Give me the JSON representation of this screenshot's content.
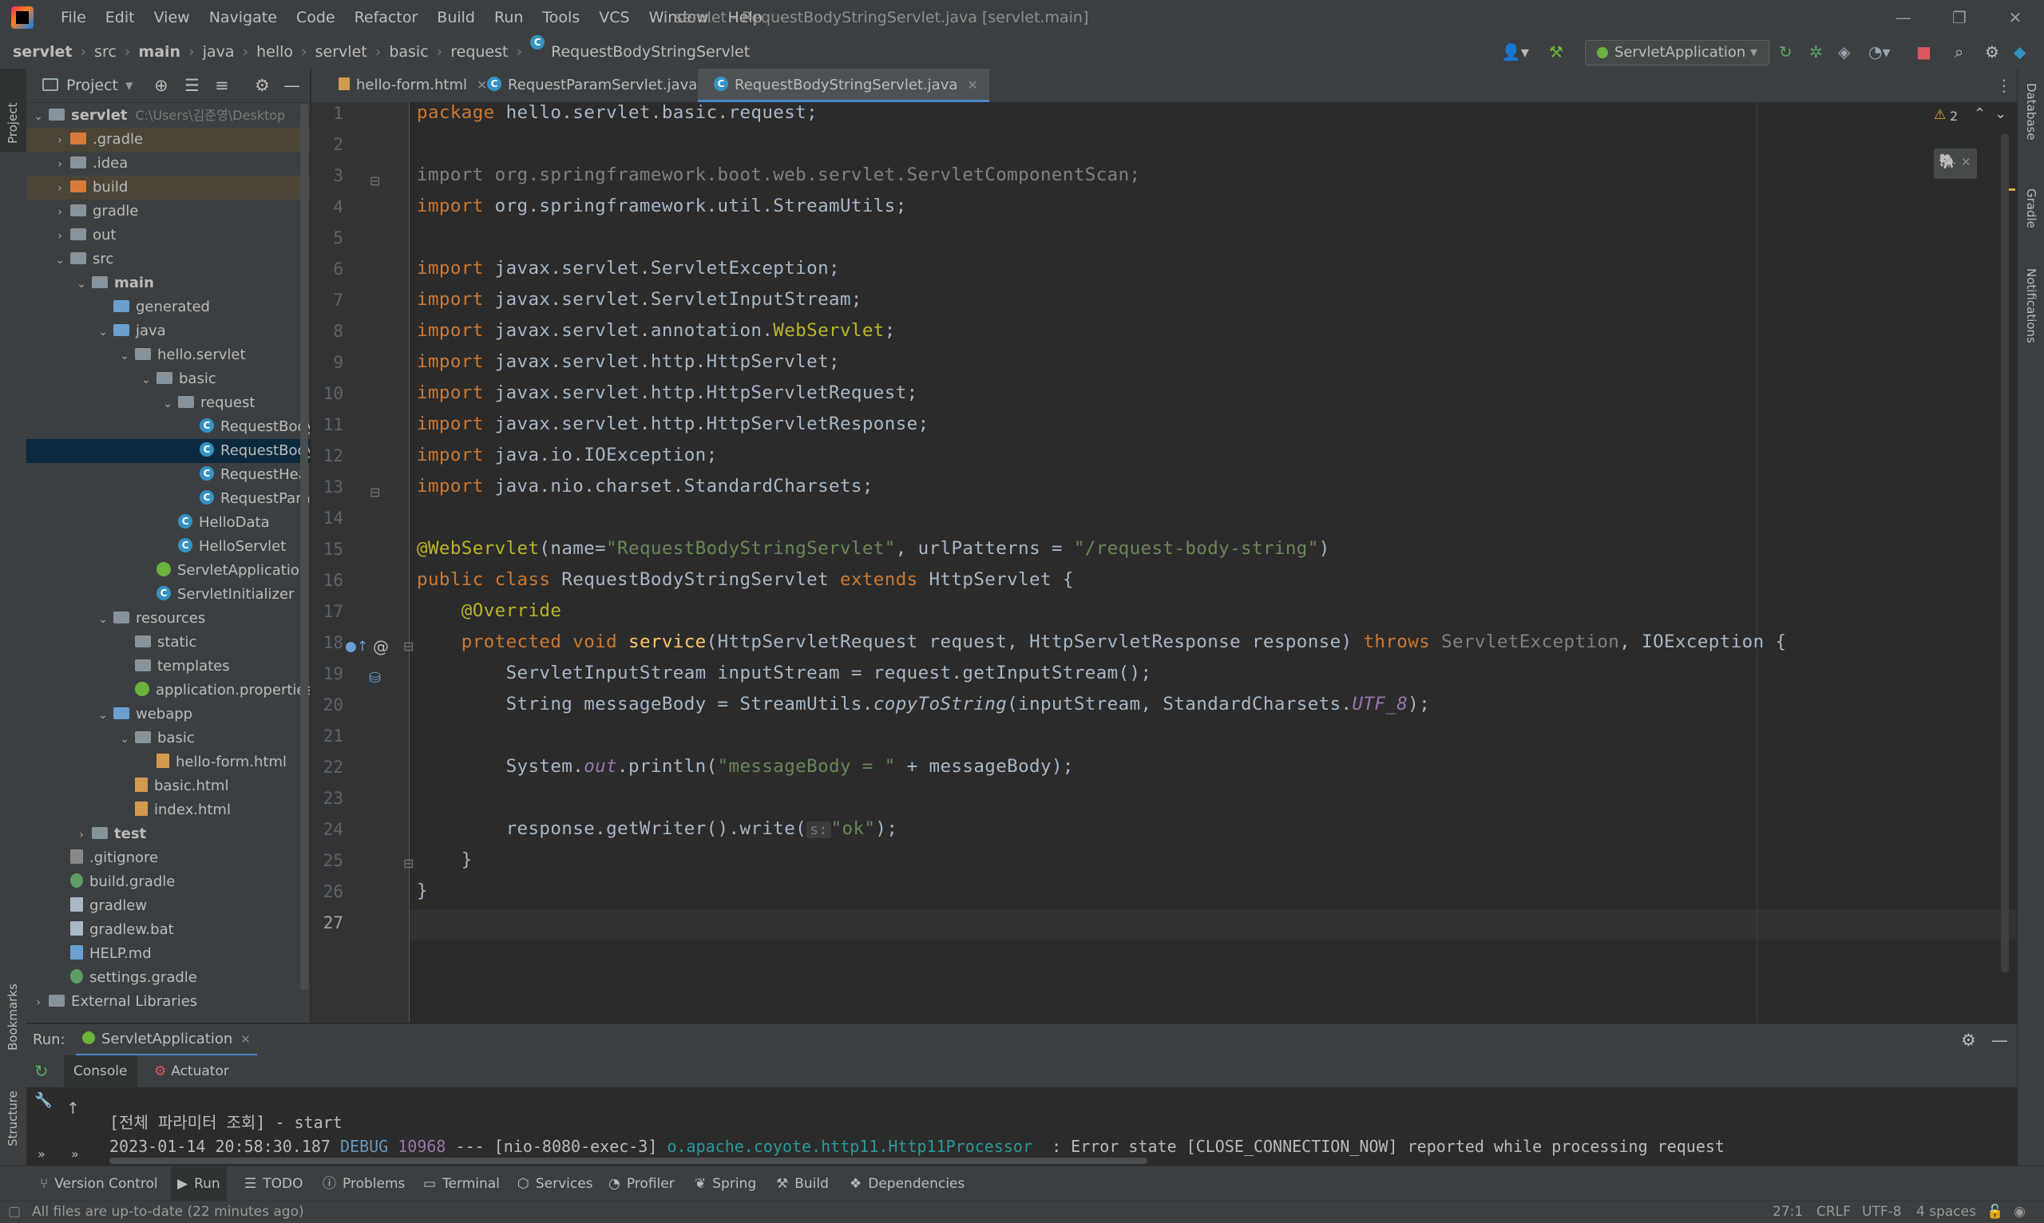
{
  "menu": {
    "items": [
      "File",
      "Edit",
      "View",
      "Navigate",
      "Code",
      "Refactor",
      "Build",
      "Run",
      "Tools",
      "VCS",
      "Window",
      "Help"
    ],
    "window_title": "servlet - RequestBodyStringServlet.java [servlet.main]"
  },
  "breadcrumb": [
    "servlet",
    "src",
    "main",
    "java",
    "hello",
    "servlet",
    "basic",
    "request",
    "RequestBodyStringServlet"
  ],
  "toolbar": {
    "run_config": "ServletApplication"
  },
  "project_panel": {
    "title": "Project",
    "tree": [
      {
        "label": "servlet",
        "path": "C:\\Users\\김준영\\Desktop",
        "depth": 0,
        "arrow": "down",
        "icon": "folder",
        "bold": true
      },
      {
        "label": ".gradle",
        "depth": 1,
        "arrow": "right",
        "icon": "folder-orange",
        "highlight": true
      },
      {
        "label": ".idea",
        "depth": 1,
        "arrow": "right",
        "icon": "folder"
      },
      {
        "label": "build",
        "depth": 1,
        "arrow": "right",
        "icon": "folder-orange",
        "highlight": true
      },
      {
        "label": "gradle",
        "depth": 1,
        "arrow": "right",
        "icon": "folder"
      },
      {
        "label": "out",
        "depth": 1,
        "arrow": "right",
        "icon": "folder"
      },
      {
        "label": "src",
        "depth": 1,
        "arrow": "down",
        "icon": "folder"
      },
      {
        "label": "main",
        "depth": 2,
        "arrow": "down",
        "icon": "folder",
        "bold": true
      },
      {
        "label": "generated",
        "depth": 3,
        "arrow": "",
        "icon": "folder-blue"
      },
      {
        "label": "java",
        "depth": 3,
        "arrow": "down",
        "icon": "folder-blue"
      },
      {
        "label": "hello.servlet",
        "depth": 4,
        "arrow": "down",
        "icon": "folder"
      },
      {
        "label": "basic",
        "depth": 5,
        "arrow": "down",
        "icon": "folder"
      },
      {
        "label": "request",
        "depth": 6,
        "arrow": "down",
        "icon": "folder"
      },
      {
        "label": "RequestBody",
        "depth": 7,
        "arrow": "",
        "icon": "class"
      },
      {
        "label": "RequestBody",
        "depth": 7,
        "arrow": "",
        "icon": "class",
        "selected": true
      },
      {
        "label": "RequestHea",
        "depth": 7,
        "arrow": "",
        "icon": "class"
      },
      {
        "label": "RequestPara",
        "depth": 7,
        "arrow": "",
        "icon": "class"
      },
      {
        "label": "HelloData",
        "depth": 6,
        "arrow": "",
        "icon": "class"
      },
      {
        "label": "HelloServlet",
        "depth": 6,
        "arrow": "",
        "icon": "class"
      },
      {
        "label": "ServletApplication",
        "depth": 5,
        "arrow": "",
        "icon": "spring"
      },
      {
        "label": "ServletInitializer",
        "depth": 5,
        "arrow": "",
        "icon": "class"
      },
      {
        "label": "resources",
        "depth": 3,
        "arrow": "down",
        "icon": "folder"
      },
      {
        "label": "static",
        "depth": 4,
        "arrow": "",
        "icon": "folder"
      },
      {
        "label": "templates",
        "depth": 4,
        "arrow": "",
        "icon": "folder"
      },
      {
        "label": "application.properties",
        "depth": 4,
        "arrow": "",
        "icon": "spring"
      },
      {
        "label": "webapp",
        "depth": 3,
        "arrow": "down",
        "icon": "folder-blue"
      },
      {
        "label": "basic",
        "depth": 4,
        "arrow": "down",
        "icon": "folder"
      },
      {
        "label": "hello-form.html",
        "depth": 5,
        "arrow": "",
        "icon": "html"
      },
      {
        "label": "basic.html",
        "depth": 4,
        "arrow": "",
        "icon": "html"
      },
      {
        "label": "index.html",
        "depth": 4,
        "arrow": "",
        "icon": "html"
      },
      {
        "label": "test",
        "depth": 2,
        "arrow": "right",
        "icon": "folder",
        "bold": true
      },
      {
        "label": ".gitignore",
        "depth": 1,
        "arrow": "",
        "icon": "git"
      },
      {
        "label": "build.gradle",
        "depth": 1,
        "arrow": "",
        "icon": "gradle"
      },
      {
        "label": "gradlew",
        "depth": 1,
        "arrow": "",
        "icon": "file"
      },
      {
        "label": "gradlew.bat",
        "depth": 1,
        "arrow": "",
        "icon": "file"
      },
      {
        "label": "HELP.md",
        "depth": 1,
        "arrow": "",
        "icon": "md"
      },
      {
        "label": "settings.gradle",
        "depth": 1,
        "arrow": "",
        "icon": "gradle"
      },
      {
        "label": "External Libraries",
        "depth": 0,
        "arrow": "right",
        "icon": "lib"
      }
    ]
  },
  "tabs": [
    {
      "label": "hello-form.html",
      "icon": "html",
      "active": false
    },
    {
      "label": "RequestParamServlet.java",
      "icon": "class",
      "active": false
    },
    {
      "label": "RequestBodyStringServlet.java",
      "icon": "class",
      "active": true
    }
  ],
  "editor": {
    "warning_count": "2",
    "line_numbers": [
      "1",
      "2",
      "3",
      "4",
      "5",
      "6",
      "7",
      "8",
      "9",
      "10",
      "11",
      "12",
      "13",
      "14",
      "15",
      "16",
      "17",
      "18",
      "19",
      "20",
      "21",
      "22",
      "23",
      "24",
      "25",
      "26",
      "27"
    ],
    "code": {
      "l1_kw": "package",
      "l1_rest": " hello.servlet.basic.request;",
      "l3": "import org.springframework.boot.web.servlet.ServletComponentScan;",
      "l4_kw": "import",
      "l4_rest": " org.springframework.util.StreamUtils;",
      "l6_kw": "import",
      "l6_rest": " javax.servlet.ServletException;",
      "l7_kw": "import",
      "l7_rest": " javax.servlet.ServletInputStream;",
      "l8_kw": "import",
      "l8_a": " javax.servlet.annotation.",
      "l8_ann": "WebServlet",
      "l8_end": ";",
      "l9_kw": "import",
      "l9_rest": " javax.servlet.http.HttpServlet;",
      "l10_kw": "import",
      "l10_rest": " javax.servlet.http.HttpServletRequest;",
      "l11_kw": "import",
      "l11_rest": " javax.servlet.http.HttpServletResponse;",
      "l12_kw": "import",
      "l12_rest": " java.io.IOException;",
      "l13_kw": "import",
      "l13_rest": " java.nio.charset.StandardCharsets;",
      "l15_ann": "@WebServlet",
      "l15_a": "(name=",
      "l15_s1": "\"RequestBodyStringServlet\"",
      "l15_b": ", urlPatterns = ",
      "l15_s2": "\"/request-body-string\"",
      "l15_c": ")",
      "l16_kw1": "public class",
      "l16_a": " RequestBodyStringServlet ",
      "l16_kw2": "extends",
      "l16_b": " HttpServlet {",
      "l17_ann": "@Override",
      "l18_kw": "protected void",
      "l18_fn": " service",
      "l18_a": "(HttpServletRequest request, HttpServletResponse response) ",
      "l18_kw2": "throws",
      "l18_gray": " ServletException",
      "l18_c": ", IOException {",
      "l19": "ServletInputStream inputStream = request.getInputStream();",
      "l20_a": "String messageBody = StreamUtils.",
      "l20_it": "copyToString",
      "l20_b": "(inputStream, StandardCharsets.",
      "l20_const": "UTF_8",
      "l20_c": ");",
      "l22_a": "System.",
      "l22_it": "out",
      "l22_b": ".println(",
      "l22_s": "\"messageBody = \"",
      "l22_c": " + messageBody);",
      "l24_a": "response.getWriter().write(",
      "l24_hint": "s:",
      "l24_s": "\"ok\"",
      "l24_c": ");",
      "l25": "}",
      "l26": "}"
    }
  },
  "run_panel": {
    "label": "Run:",
    "config_tab": "ServletApplication",
    "tabs": [
      "Console",
      "Actuator"
    ],
    "console": {
      "line1": "[전체 파라미터 조회] - start",
      "line2_time": "2023-01-14 20:58:30.187",
      "line2_level": "DEBUG",
      "line2_pid": "10968",
      "line2_mid": "--- [nio-8080-exec-3]",
      "line2_logger": "o.apache.coyote.http11.Http11Processor",
      "line2_msg": "  : Error state [CLOSE_CONNECTION_NOW] reported while processing request"
    }
  },
  "side_tools": {
    "left": [
      "Project",
      "Bookmarks",
      "Structure"
    ],
    "right": [
      "Database",
      "Gradle",
      "Notifications"
    ]
  },
  "bottom_tabs": [
    "Version Control",
    "Run",
    "TODO",
    "Problems",
    "Terminal",
    "Services",
    "Profiler",
    "Spring",
    "Build",
    "Dependencies"
  ],
  "status": {
    "message": "All files are up-to-date (22 minutes ago)",
    "position": "27:1",
    "line_sep": "CRLF",
    "encoding": "UTF-8",
    "indent": "4 spaces"
  }
}
